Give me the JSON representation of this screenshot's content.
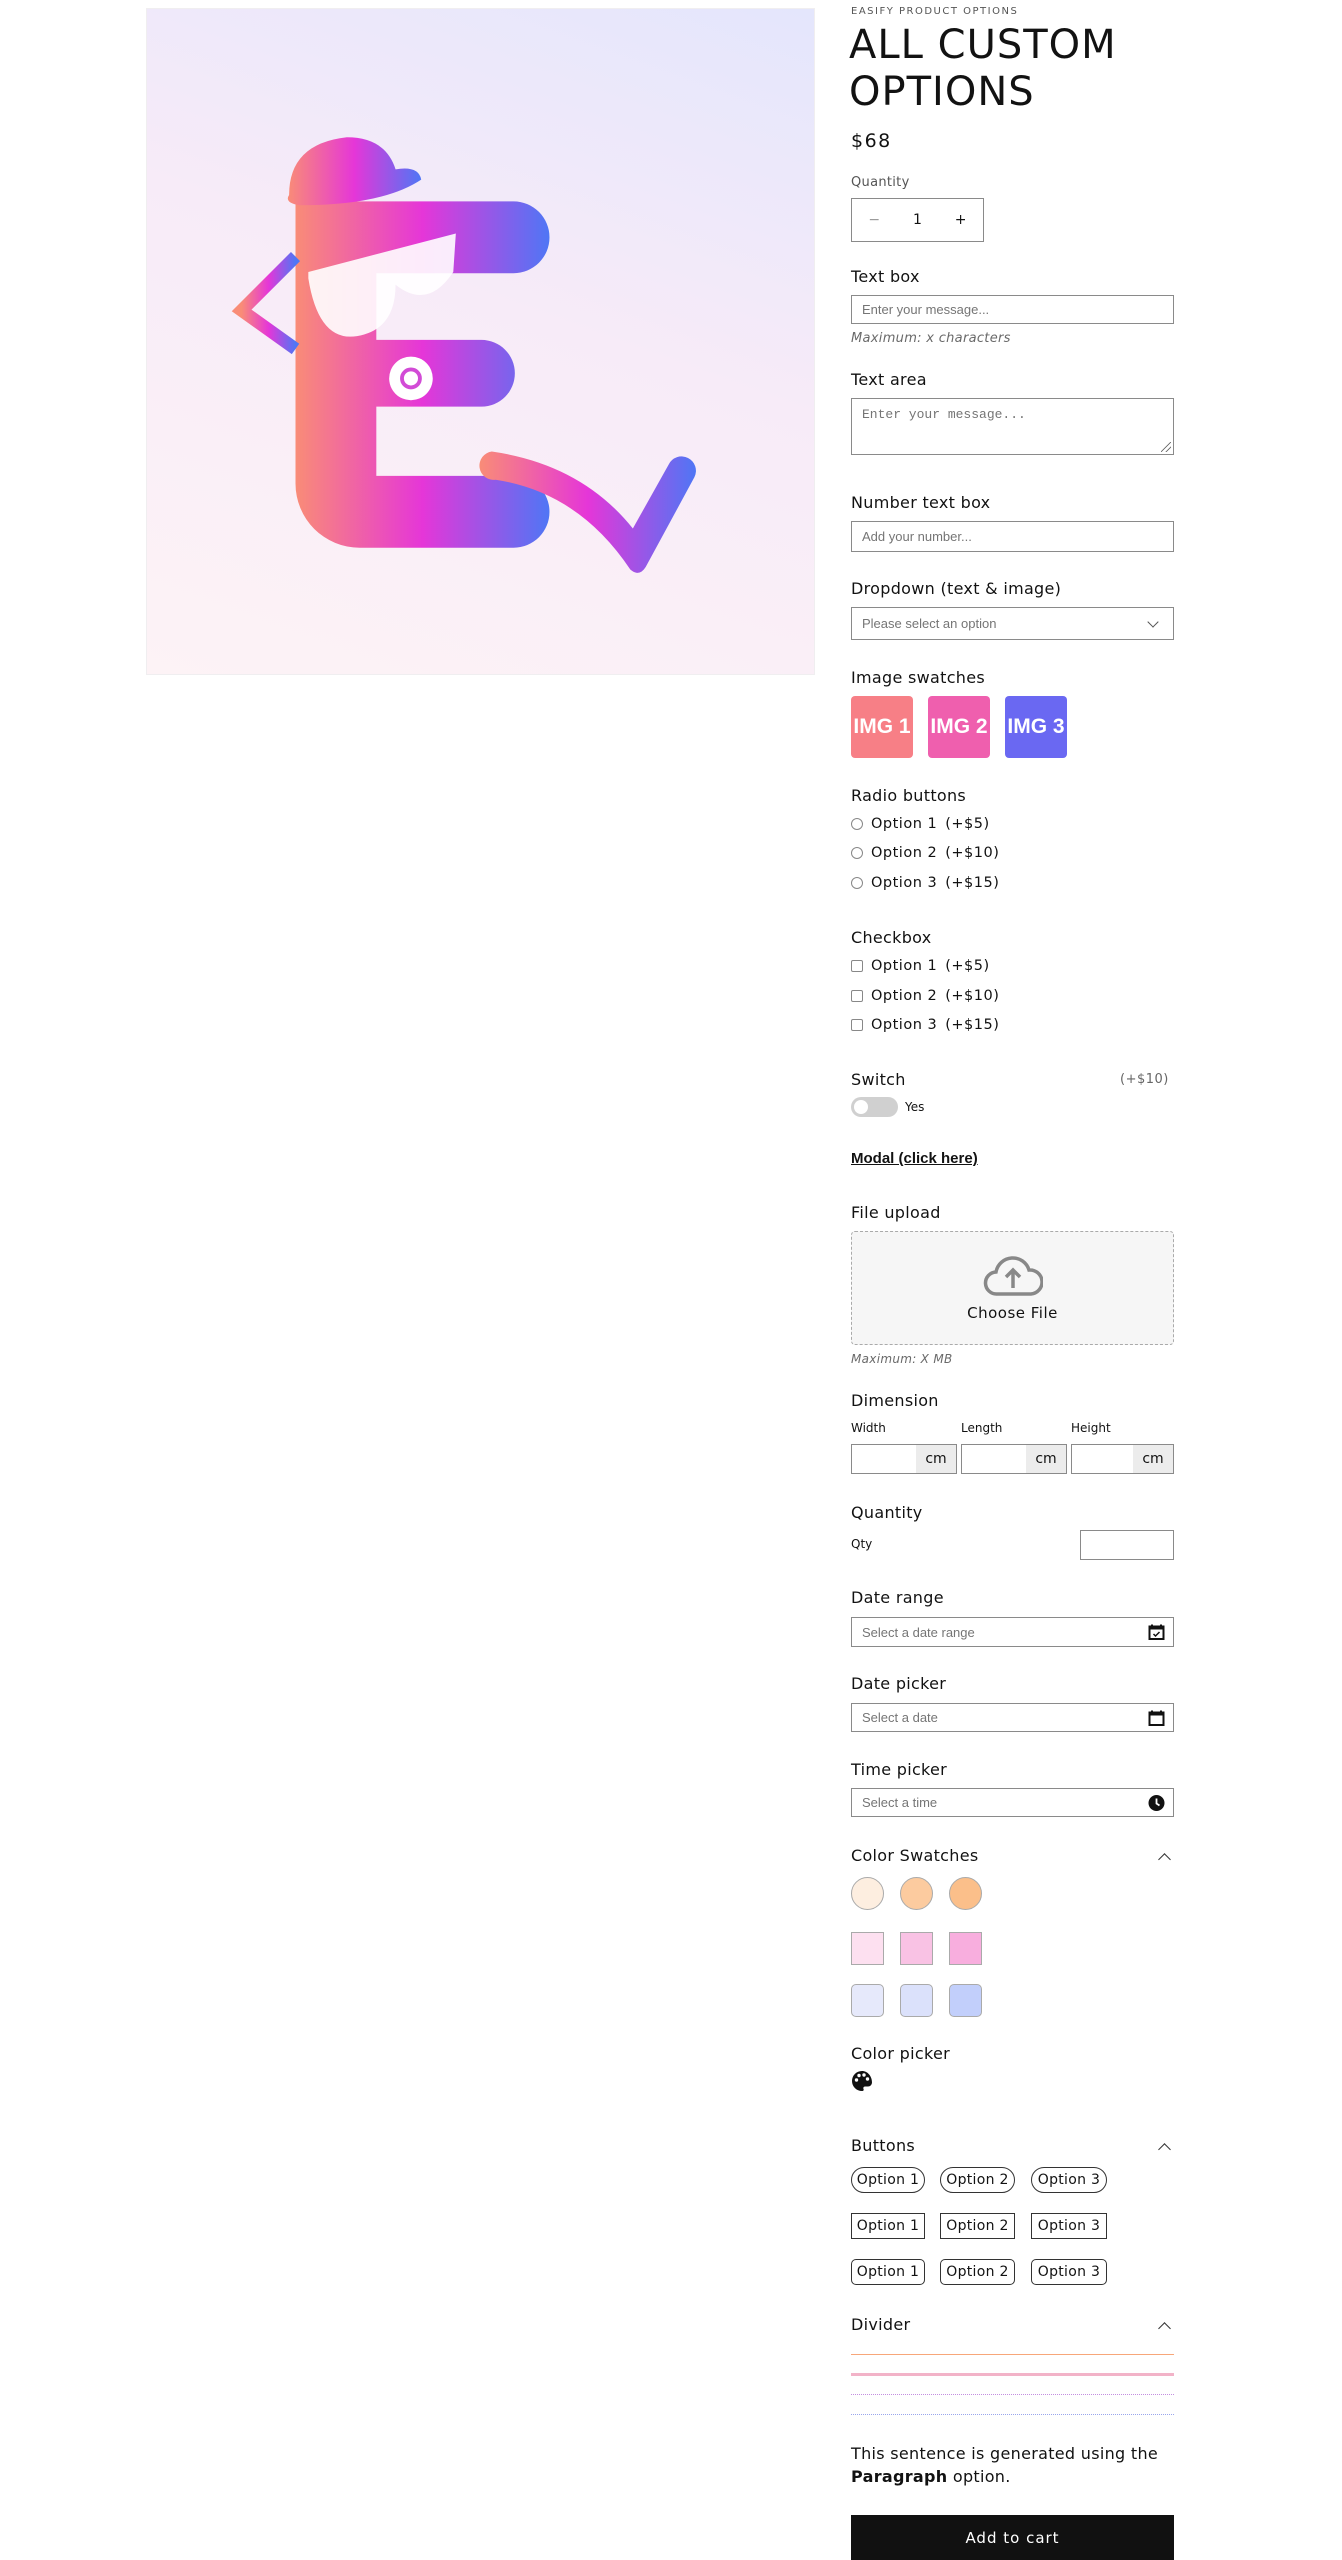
{
  "product": {
    "vendor": "EASIFY PRODUCT OPTIONS",
    "title_line1": "ALL CUSTOM",
    "title_line2": "OPTIONS",
    "price": "$68",
    "image_alt": "Easify logo"
  },
  "quantity": {
    "label": "Quantity",
    "value": "1",
    "minus": "−",
    "plus": "+"
  },
  "text_box": {
    "label": "Text box",
    "placeholder": "Enter your message...",
    "hint": "Maximum: x characters"
  },
  "text_area": {
    "label": "Text area",
    "placeholder": "Enter your message..."
  },
  "number_box": {
    "label": "Number text box",
    "placeholder": "Add your number..."
  },
  "dropdown": {
    "label": "Dropdown (text & image)",
    "selected": "Please select an option"
  },
  "image_swatches": {
    "label": "Image swatches",
    "items": [
      {
        "label": "IMG 1",
        "color": "#f77f86"
      },
      {
        "label": "IMG 2",
        "color": "#ef5fae"
      },
      {
        "label": "IMG 3",
        "color": "#6a68f2"
      }
    ]
  },
  "radio": {
    "label": "Radio buttons",
    "options": [
      {
        "label": "Option 1",
        "price": "(+$5)"
      },
      {
        "label": "Option 2",
        "price": "(+$10)"
      },
      {
        "label": "Option 3",
        "price": "(+$15)"
      }
    ]
  },
  "checkbox": {
    "label": "Checkbox",
    "options": [
      {
        "label": "Option 1",
        "price": "(+$5)"
      },
      {
        "label": "Option 2",
        "price": "(+$10)"
      },
      {
        "label": "Option 3",
        "price": "(+$15)"
      }
    ]
  },
  "switch": {
    "label": "Switch",
    "price": "(+$10)",
    "text": "Yes",
    "on": false
  },
  "modal": {
    "link": "Modal (click here)"
  },
  "file_upload": {
    "label": "File upload",
    "button": "Choose File",
    "hint": "Maximum: X MB"
  },
  "dimension": {
    "label": "Dimension",
    "fields": [
      {
        "label": "Width",
        "unit": "cm"
      },
      {
        "label": "Length",
        "unit": "cm"
      },
      {
        "label": "Height",
        "unit": "cm"
      }
    ]
  },
  "quantity2": {
    "label": "Quantity",
    "sublabel": "Qty"
  },
  "date_range": {
    "label": "Date range",
    "placeholder": "Select a date range"
  },
  "date_picker": {
    "label": "Date picker",
    "placeholder": "Select a date"
  },
  "time_picker": {
    "label": "Time picker",
    "placeholder": "Select a time"
  },
  "color_swatches": {
    "label": "Color Swatches",
    "rows": [
      [
        "#fdeee0",
        "#fccb9f",
        "#fbbf8a"
      ],
      [
        "#fde0f0",
        "#f9c2e4",
        "#f8aede"
      ],
      [
        "#e6e9fb",
        "#dbe1fb",
        "#c2cffb"
      ]
    ]
  },
  "color_picker": {
    "label": "Color picker"
  },
  "buttons": {
    "label": "Buttons",
    "rows": [
      [
        "Option 1",
        "Option 2",
        "Option 3"
      ],
      [
        "Option 1",
        "Option 2",
        "Option 3"
      ],
      [
        "Option 1",
        "Option 2",
        "Option 3"
      ]
    ]
  },
  "divider": {
    "label": "Divider",
    "colors": [
      "#f7a77a",
      "#f2b3c8",
      "#c48ee0",
      "#9aa6ec"
    ]
  },
  "paragraph": {
    "text": "This sentence is generated using the",
    "bold": "Paragraph",
    "rest": "option."
  },
  "cart": {
    "label": "Add to cart"
  }
}
